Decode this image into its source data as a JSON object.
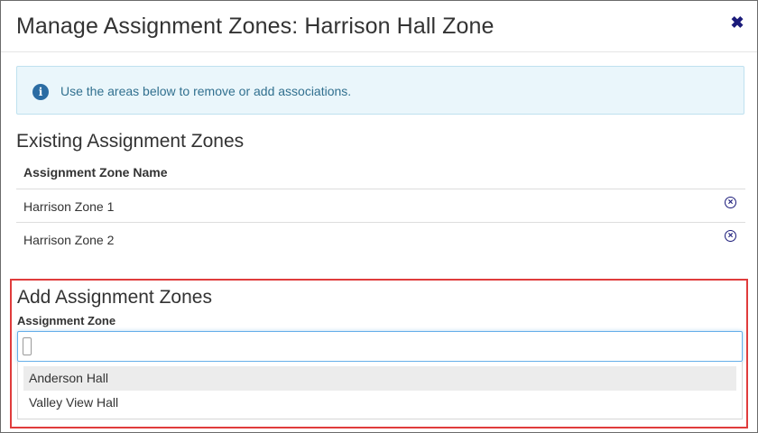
{
  "modal": {
    "title": "Manage Assignment Zones: Harrison Hall Zone",
    "close_glyph": "✖"
  },
  "info": {
    "icon": "info-icon",
    "icon_glyph": "i",
    "text": "Use the areas below to remove or add associations."
  },
  "existing": {
    "title": "Existing Assignment Zones",
    "column_header": "Assignment Zone Name",
    "rows": [
      {
        "name": "Harrison Zone 1",
        "remove_glyph": "×"
      },
      {
        "name": "Harrison Zone 2",
        "remove_glyph": "×"
      }
    ]
  },
  "add": {
    "title": "Add Assignment Zones",
    "field_label": "Assignment Zone",
    "input_value": "",
    "options": [
      "Anderson Hall",
      "Valley View Hall"
    ],
    "highlighted_option": "Anderson Hall"
  },
  "colors": {
    "accent": "#1b1b7a",
    "info_bg": "#eaf6fb",
    "info_text": "#31708f",
    "highlight_border": "#e03c3c",
    "input_focus": "#66afe9"
  }
}
